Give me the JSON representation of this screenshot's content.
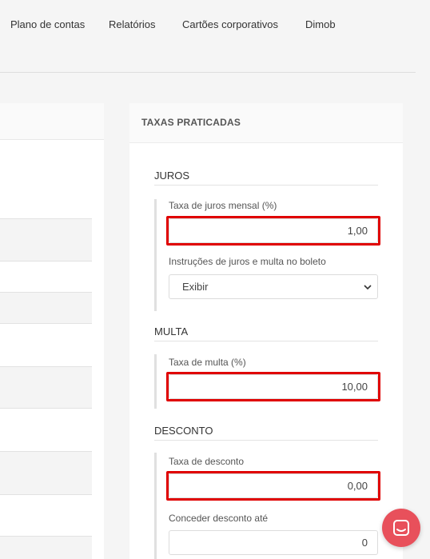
{
  "nav": {
    "items": [
      "Plano de contas",
      "Relatórios",
      "Cartões corporativos",
      "Dimob"
    ]
  },
  "panel": {
    "title": "TAXAS PRATICADAS"
  },
  "juros": {
    "section": "JUROS",
    "rate_label": "Taxa de juros mensal (%)",
    "rate_value": "1,00",
    "instructions_label": "Instruções de juros e multa no boleto",
    "instructions_value": "Exibir"
  },
  "multa": {
    "section": "MULTA",
    "rate_label": "Taxa de multa (%)",
    "rate_value": "10,00"
  },
  "desconto": {
    "section": "DESCONTO",
    "rate_label": "Taxa de desconto",
    "rate_value": "0,00",
    "until_label": "Conceder desconto até",
    "until_value": "0"
  },
  "colors": {
    "highlight": "#e00000",
    "chat_button": "#e8505b"
  },
  "icons": {
    "select": "chevron-down-icon",
    "chat": "chat-icon"
  }
}
